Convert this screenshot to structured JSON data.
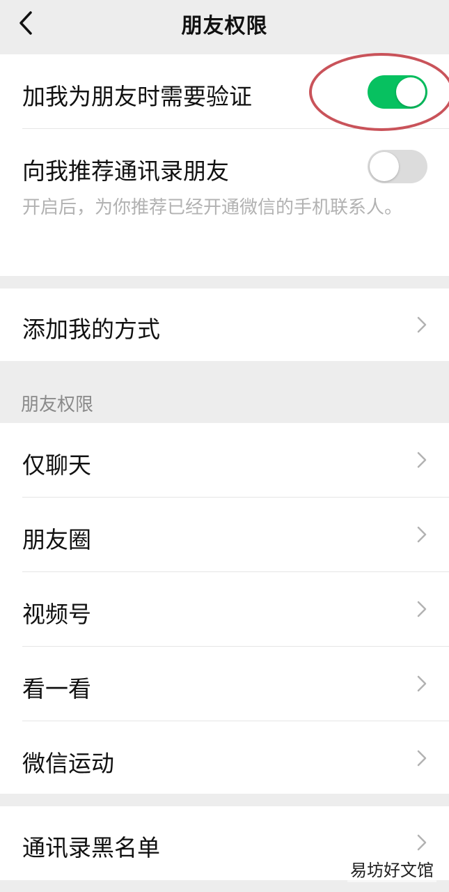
{
  "header": {
    "title": "朋友权限"
  },
  "verification": {
    "label": "加我为朋友时需要验证",
    "enabled": true
  },
  "recommend": {
    "label": "向我推荐通讯录朋友",
    "enabled": false,
    "hint": "开启后，为你推荐已经开通微信的手机联系人。"
  },
  "add_methods": {
    "label": "添加我的方式"
  },
  "permissions_section": {
    "header": "朋友权限",
    "items": [
      {
        "label": "仅聊天"
      },
      {
        "label": "朋友圈"
      },
      {
        "label": "视频号"
      },
      {
        "label": "看一看"
      },
      {
        "label": "微信运动"
      }
    ]
  },
  "blacklist": {
    "label": "通讯录黑名单"
  },
  "watermark": "易坊好文馆",
  "colors": {
    "toggle_on": "#07c160",
    "toggle_off": "#dcdcdc",
    "annotation": "#c9535a",
    "background": "#ededed"
  }
}
